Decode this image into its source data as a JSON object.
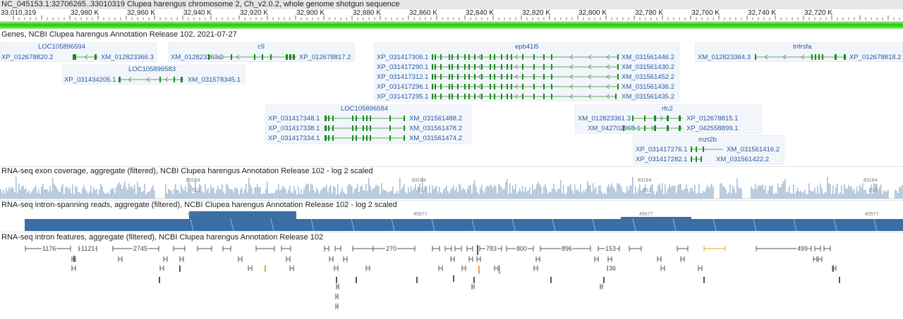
{
  "title": "NC_045153.1:32706265..33010319 Clupea harengus chromosome 2, Ch_v2.0.2, whole genome shotgun sequence",
  "ruler": {
    "start_label": "33,010,319",
    "ticks": [
      "32,980 K",
      "32,960 K",
      "32,940 K",
      "32,920 K",
      "32,900 K",
      "32,880 K",
      "32,860 K",
      "32,840 K",
      "32,820 K",
      "32,800 K",
      "32,780 K",
      "32,760 K",
      "32,740 K",
      "32,720 K"
    ]
  },
  "tracks": {
    "genes": "Genes, NCBI Clupea harengus Annotation Release 102, 2021-07-27",
    "exon_coverage": "RNA-seq exon coverage, aggregate (filtered), NCBI Clupea harengus Annotation Release 102 - log 2 scaled",
    "intron_reads": "RNA-seq intron-spanning reads, aggregate (filtered), NCBI Clupea harengus Annotation Release 102 - log 2 scaled",
    "intron_features": "RNA-seq intron features, aggregate (filtered), NCBI Clupea harengus Annotation Release 102"
  },
  "genes": [
    {
      "name": "LOC105896594",
      "left": "XP_012678820.2",
      "right": "XM_012823366.3"
    },
    {
      "name": "c9",
      "left": "XM_012823363.3",
      "right": "XP_012678817.2"
    },
    {
      "name": "epb41l5",
      "rows": [
        {
          "left": "XP_031417306.1",
          "right": "XM_031561446.2"
        },
        {
          "left": "XP_031417290.1",
          "right": "XM_031561430.2"
        },
        {
          "left": "XP_031417312.1",
          "right": "XM_031561452.2"
        },
        {
          "left": "XP_031417296.1",
          "right": "XM_031561436.2"
        },
        {
          "left": "XP_031417295.1",
          "right": "XM_031561435.2"
        }
      ]
    },
    {
      "name": "tnfrsfa",
      "left": "XM_012823364.3",
      "right": "XP_012678818.2"
    },
    {
      "name": "LOC105896583",
      "left": "XP_031434205.1",
      "right": "XM_031578345.1"
    },
    {
      "name": "LOC105896584",
      "rows": [
        {
          "left": "XP_031417348.1",
          "right": "XM_031561488.2"
        },
        {
          "left": "XP_031417338.1",
          "right": "XM_031561478.2"
        },
        {
          "left": "XP_031417334.1",
          "right": "XM_031561474.2"
        }
      ]
    },
    {
      "name": "rfc2",
      "rows": [
        {
          "left": "XM_012823361.3",
          "right": "XP_012678815.1"
        },
        {
          "left": "XM_042702965.1",
          "right": "XP_042558899.1"
        }
      ]
    },
    {
      "name": "mzt2b",
      "rows": [
        {
          "left": "XP_031417276.1",
          "right": "XM_031561416.2"
        },
        {
          "left": "XP_031417282.1",
          "right": "XM_031561422.2"
        }
      ]
    }
  ],
  "coverage": {
    "max_label": "83164",
    "min_label": "512",
    "intron_max_label": "45577"
  },
  "intron_feature_counts": [
    "1176",
    "1121",
    "2745",
    "270",
    "783",
    "800",
    "896",
    "153",
    "36",
    "499"
  ],
  "colors": {
    "gene": "#1f8a1f",
    "gene_label": "#2a57a3",
    "coverage": "#a9bfd6",
    "intron_reads": "#3a6ea5",
    "feature": "#555555",
    "feature_highlight": "#e8a33a"
  }
}
